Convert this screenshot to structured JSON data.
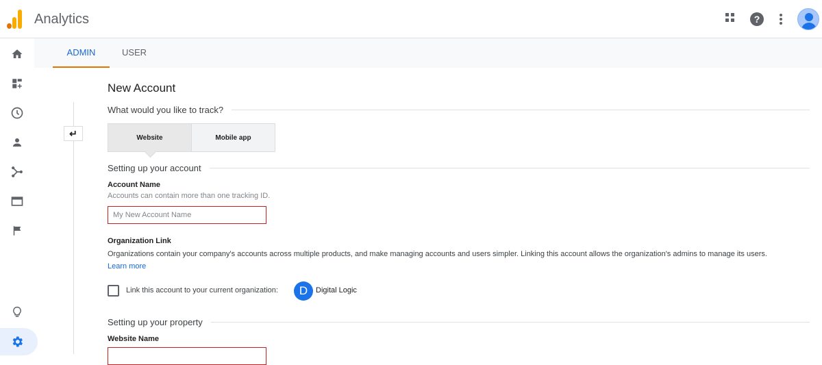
{
  "app": {
    "title": "Analytics"
  },
  "header": {
    "icons": [
      "apps-grid-icon",
      "help-icon",
      "more-vert-icon",
      "account-avatar"
    ]
  },
  "sidebar": {
    "items": [
      "home-icon",
      "customization-icon",
      "realtime-icon",
      "audience-icon",
      "acquisition-icon",
      "behavior-icon",
      "conversions-icon",
      "discover-icon",
      "admin-gear-icon"
    ],
    "active_color": "#1a73e8"
  },
  "tabs": [
    {
      "label": "ADMIN",
      "active": true
    },
    {
      "label": "USER",
      "active": false
    }
  ],
  "form": {
    "title": "New Account",
    "track_question": "What would you like to track?",
    "track_options": [
      {
        "label": "Website",
        "selected": true
      },
      {
        "label": "Mobile app",
        "selected": false
      }
    ],
    "account_section": "Setting up your account",
    "account_name_label": "Account Name",
    "account_name_hint": "Accounts can contain more than one tracking ID.",
    "account_name_placeholder": "My New Account Name",
    "org_label": "Organization Link",
    "org_desc": "Organizations contain your company's accounts across multiple products, and make managing accounts and users simpler. Linking this account allows the organization's admins to manage its users.",
    "learn_more": "Learn more",
    "link_checkbox_label": "Link this account to your current organization:",
    "org_initial": "D",
    "org_name": "Digital Logic",
    "property_section": "Setting up your property",
    "website_name_label": "Website Name"
  },
  "colors": {
    "accent_blue": "#1967d2",
    "tab_underline": "#e37400",
    "error_border": "#c5221f"
  }
}
